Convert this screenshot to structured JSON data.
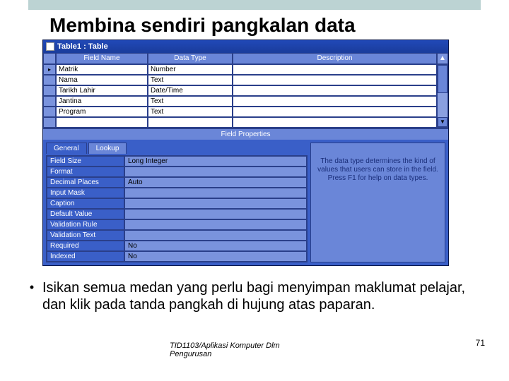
{
  "title": "Membina sendiri pangkalan data",
  "window": {
    "titlebar": "Table1 : Table",
    "columns": {
      "field_name": "Field Name",
      "data_type": "Data Type",
      "description": "Description"
    },
    "rows": [
      {
        "sel": "▸",
        "field": "Matrik",
        "type": "Number"
      },
      {
        "sel": "",
        "field": "Nama",
        "type": "Text"
      },
      {
        "sel": "",
        "field": "Tarikh Lahir",
        "type": "Date/Time"
      },
      {
        "sel": "",
        "field": "Jantina",
        "type": "Text"
      },
      {
        "sel": "",
        "field": "Program",
        "type": "Text"
      },
      {
        "sel": "",
        "field": "",
        "type": ""
      }
    ],
    "field_properties_label": "Field Properties",
    "tabs": {
      "general": "General",
      "lookup": "Lookup"
    },
    "properties": [
      {
        "name": "Field Size",
        "value": "Long Integer"
      },
      {
        "name": "Format",
        "value": ""
      },
      {
        "name": "Decimal Places",
        "value": "Auto"
      },
      {
        "name": "Input Mask",
        "value": ""
      },
      {
        "name": "Caption",
        "value": ""
      },
      {
        "name": "Default Value",
        "value": ""
      },
      {
        "name": "Validation Rule",
        "value": ""
      },
      {
        "name": "Validation Text",
        "value": ""
      },
      {
        "name": "Required",
        "value": "No"
      },
      {
        "name": "Indexed",
        "value": "No"
      }
    ],
    "help_text": "The data type determines the kind of values that users can store in the field. Press F1 for help on data types.",
    "scroll_up": "▲",
    "scroll_down": "▼"
  },
  "bullet": "Isikan semua medan yang perlu bagi menyimpan maklumat pelajar, dan klik pada tanda pangkah di hujung atas paparan.",
  "footer_line1": "TID1103/Aplikasi Komputer Dlm",
  "footer_line2": "Pengurusan",
  "page_number": "71"
}
